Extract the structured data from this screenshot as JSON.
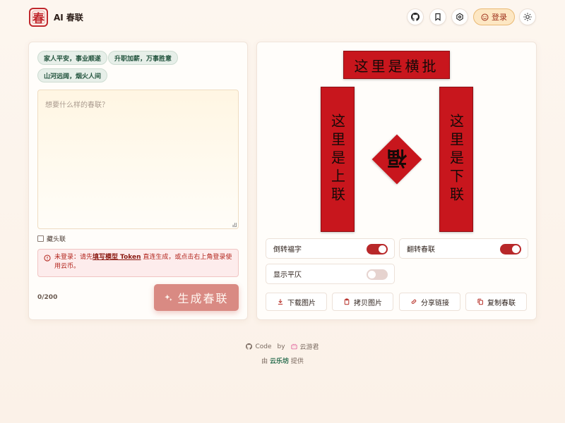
{
  "header": {
    "logo_char": "春",
    "title": "AI 春联",
    "login_label": "登录"
  },
  "chips": [
    "家人平安，事业顺遂",
    "升职加薪，万事胜意",
    "山河远阔，烟火人间"
  ],
  "input": {
    "placeholder": "想要什么样的春联？",
    "checkbox_label": "藏头联",
    "counter": "0/200"
  },
  "notice": {
    "prefix": "未登录：请先",
    "link": "填写模型 Token",
    "suffix": " 直连生成，或点击右上角登录使用云币。"
  },
  "generate_label": "生成春联",
  "couplet": {
    "horizontal": "这里是横批",
    "first": "这里是上联",
    "second": "这里是下联",
    "fu": "福",
    "color": "#c8161d"
  },
  "toggles": [
    {
      "label": "倒转福字",
      "on": true
    },
    {
      "label": "翻转春联",
      "on": true
    },
    {
      "label": "显示平仄",
      "on": false
    }
  ],
  "actions": [
    "下载图片",
    "拷贝图片",
    "分享链接",
    "复制春联"
  ],
  "footer": {
    "code": "Code",
    "by": "by",
    "author": "云游君",
    "from": "由",
    "provider": "云乐坊",
    "provide": "提供"
  }
}
